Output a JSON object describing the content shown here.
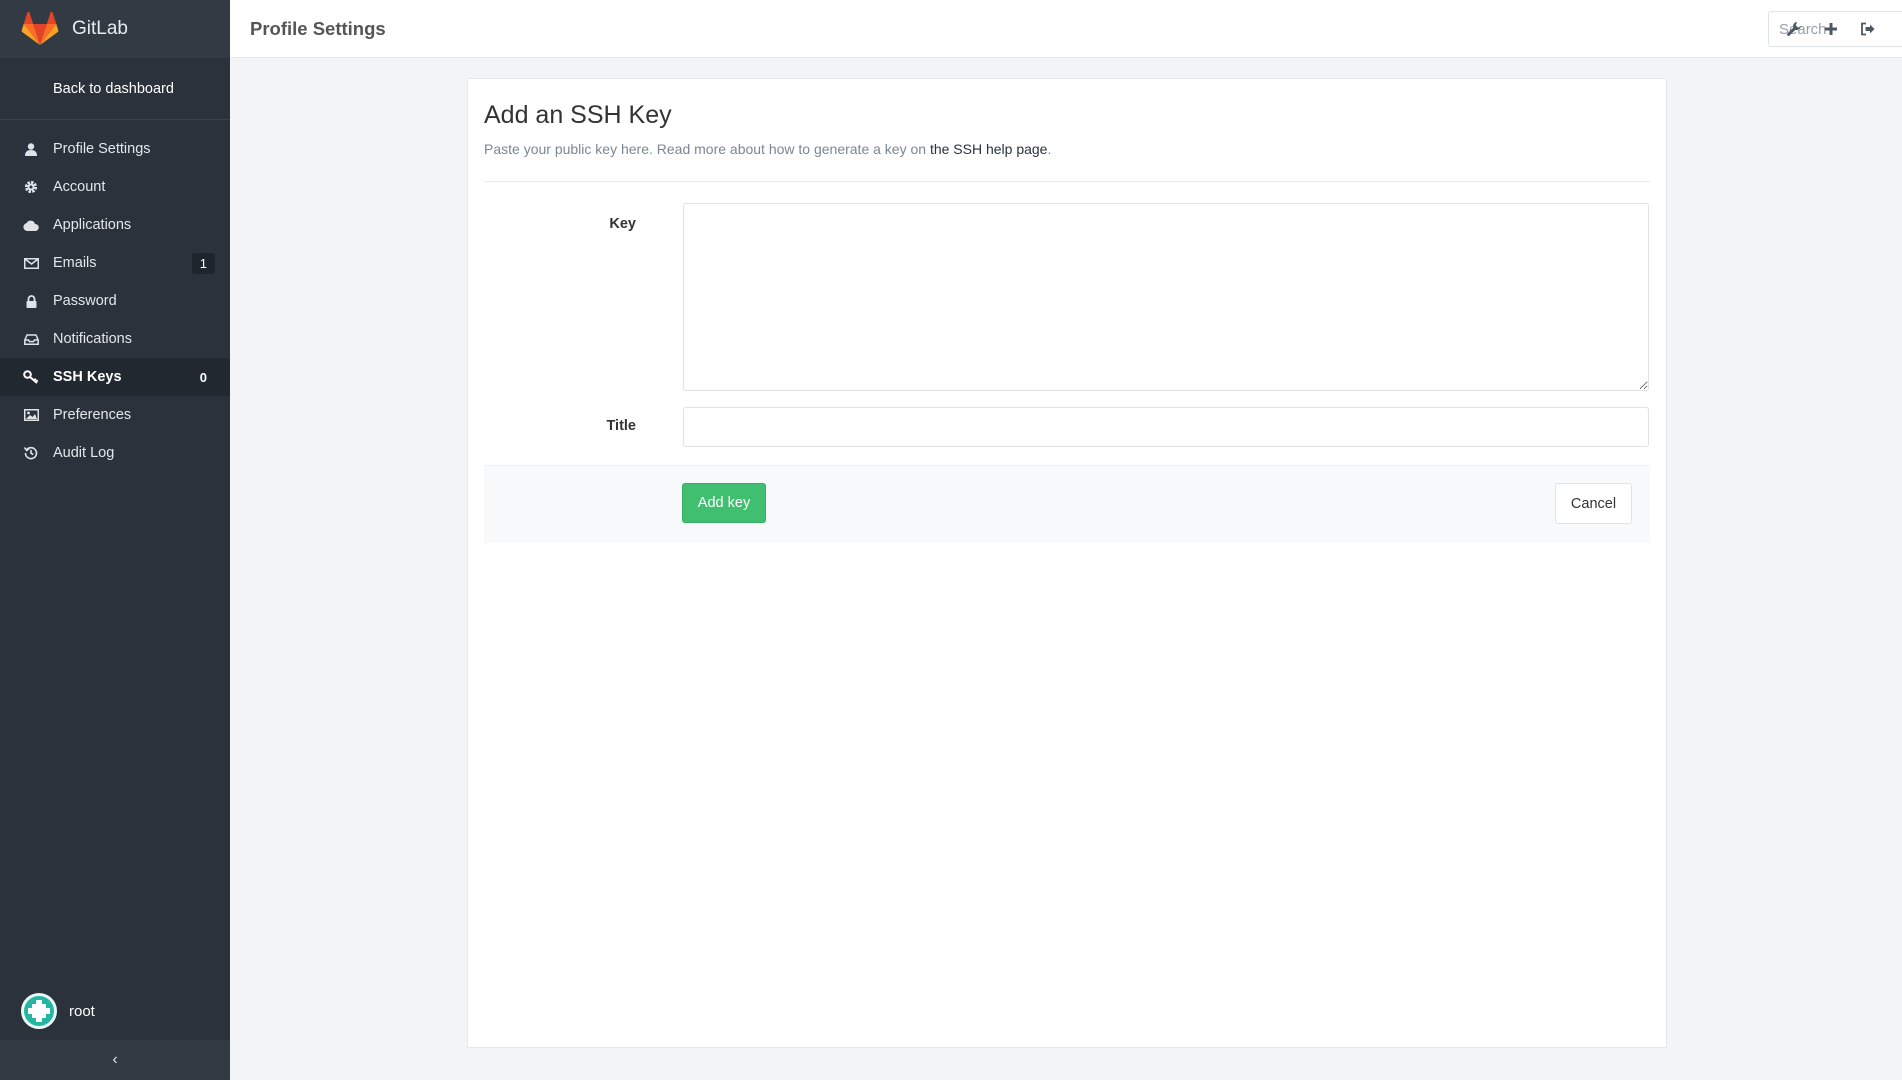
{
  "brand": {
    "name": "GitLab",
    "logo": "gitlab-fox-logo"
  },
  "sidebar": {
    "back_label": "Back to dashboard",
    "items": [
      {
        "label": "Profile Settings",
        "icon": "user-icon"
      },
      {
        "label": "Account",
        "icon": "gear-icon"
      },
      {
        "label": "Applications",
        "icon": "cloud-icon"
      },
      {
        "label": "Emails",
        "icon": "envelope-icon",
        "badge": "1"
      },
      {
        "label": "Password",
        "icon": "lock-icon"
      },
      {
        "label": "Notifications",
        "icon": "inbox-icon"
      },
      {
        "label": "SSH Keys",
        "icon": "key-icon",
        "badge": "0",
        "active": true
      },
      {
        "label": "Preferences",
        "icon": "image-icon"
      },
      {
        "label": "Audit Log",
        "icon": "history-icon"
      }
    ],
    "user": {
      "name": "root"
    },
    "collapse_glyph": "‹"
  },
  "header": {
    "title": "Profile Settings",
    "search_placeholder": "Search",
    "icons": [
      "wrench-icon",
      "plus-icon",
      "sign-out-icon"
    ]
  },
  "form": {
    "title": "Add an SSH Key",
    "description_prefix": "Paste your public key here. Read more about how to generate a key on ",
    "description_link": "the SSH help page",
    "description_suffix": ".",
    "key_label": "Key",
    "key_value": "",
    "title_label": "Title",
    "title_value": "",
    "submit_label": "Add key",
    "cancel_label": "Cancel"
  },
  "colors": {
    "sidebar_bg": "#2b323b",
    "primary_button": "#3fbf6f",
    "gitlab_orange": "#fc6d26",
    "avatar": "#26b5a3"
  }
}
